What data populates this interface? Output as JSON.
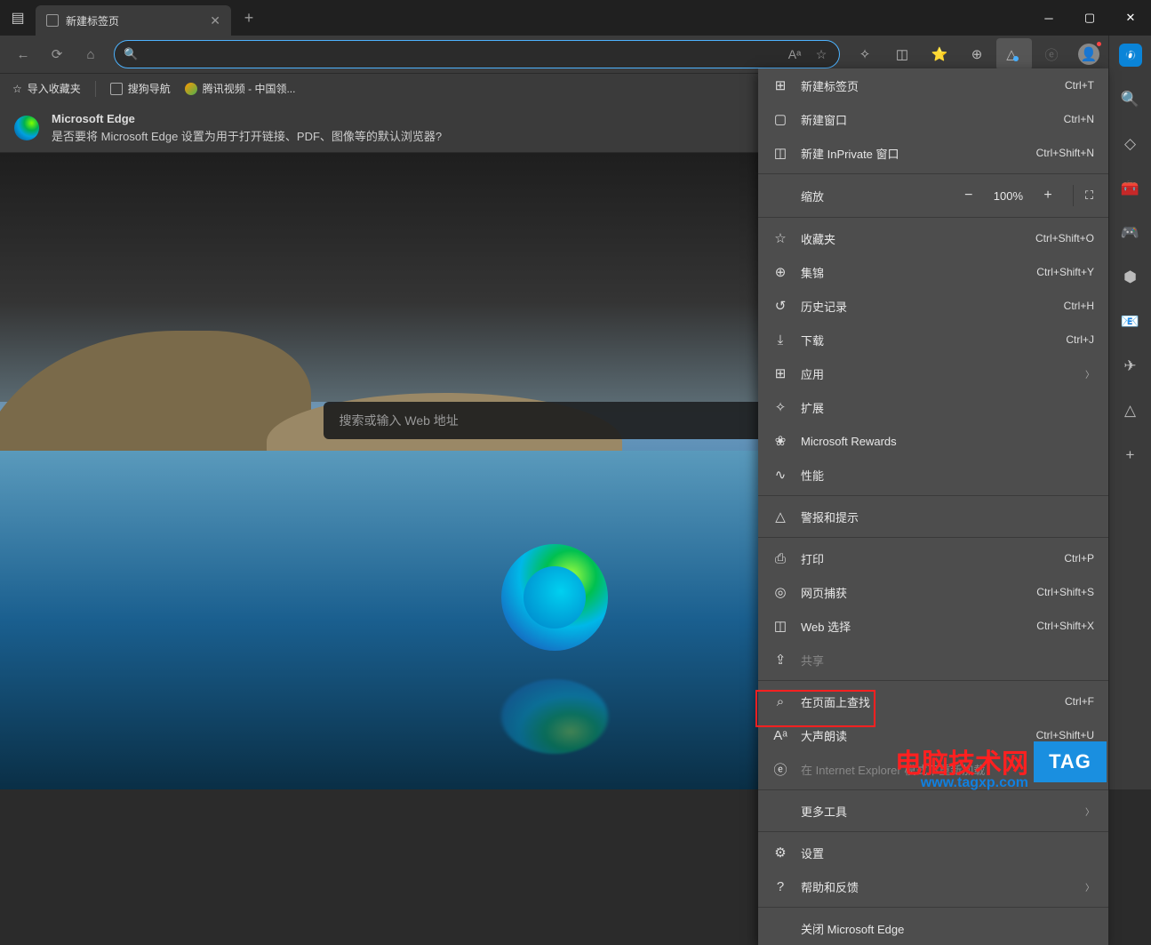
{
  "tab": {
    "title": "新建标签页"
  },
  "bookmarks": {
    "import": "导入收藏夹",
    "items": [
      {
        "label": "搜狗导航"
      },
      {
        "label": "腾讯视频 - 中国领..."
      }
    ]
  },
  "banner": {
    "title": "Microsoft Edge",
    "message": "是否要将 Microsoft Edge 设置为用于打开链接、PDF、图像等的默认浏览器?"
  },
  "search": {
    "placeholder": "搜索或输入 Web 地址"
  },
  "zoom": {
    "label": "缩放",
    "value": "100%"
  },
  "menu": [
    {
      "icon": "⊞",
      "label": "新建标签页",
      "shortcut": "Ctrl+T"
    },
    {
      "icon": "▢",
      "label": "新建窗口",
      "shortcut": "Ctrl+N"
    },
    {
      "icon": "◫",
      "label": "新建 InPrivate 窗口",
      "shortcut": "Ctrl+Shift+N"
    },
    {
      "sep": true
    },
    {
      "zoom": true
    },
    {
      "sep": true
    },
    {
      "icon": "☆",
      "label": "收藏夹",
      "shortcut": "Ctrl+Shift+O"
    },
    {
      "icon": "⊕",
      "label": "集锦",
      "shortcut": "Ctrl+Shift+Y"
    },
    {
      "icon": "↺",
      "label": "历史记录",
      "shortcut": "Ctrl+H"
    },
    {
      "icon": "⤓",
      "label": "下载",
      "shortcut": "Ctrl+J"
    },
    {
      "icon": "⊞",
      "label": "应用",
      "arrow": true
    },
    {
      "icon": "✧",
      "label": "扩展"
    },
    {
      "icon": "❀",
      "label": "Microsoft Rewards"
    },
    {
      "icon": "∿",
      "label": "性能"
    },
    {
      "sep": true
    },
    {
      "icon": "△",
      "label": "警报和提示"
    },
    {
      "sep": true
    },
    {
      "icon": "⎙",
      "label": "打印",
      "shortcut": "Ctrl+P"
    },
    {
      "icon": "◎",
      "label": "网页捕获",
      "shortcut": "Ctrl+Shift+S"
    },
    {
      "icon": "◫",
      "label": "Web 选择",
      "shortcut": "Ctrl+Shift+X"
    },
    {
      "icon": "⇪",
      "label": "共享",
      "disabled": true
    },
    {
      "sep": true
    },
    {
      "icon": "⌕",
      "label": "在页面上查找",
      "shortcut": "Ctrl+F"
    },
    {
      "icon": "Aᵃ",
      "label": "大声朗读",
      "shortcut": "Ctrl+Shift+U"
    },
    {
      "icon": "ⓔ",
      "label": "在 Internet Explorer 模式下重新加载",
      "disabled": true
    },
    {
      "sep": true
    },
    {
      "icon": "",
      "label": "更多工具",
      "arrow": true
    },
    {
      "sep": true
    },
    {
      "icon": "⚙",
      "label": "设置"
    },
    {
      "icon": "?",
      "label": "帮助和反馈",
      "arrow": true
    },
    {
      "sep": true
    },
    {
      "icon": "",
      "label": "关闭 Microsoft Edge"
    }
  ],
  "watermark": {
    "text": "电脑技术网",
    "url": "www.tagxp.com",
    "badge": "TAG"
  }
}
